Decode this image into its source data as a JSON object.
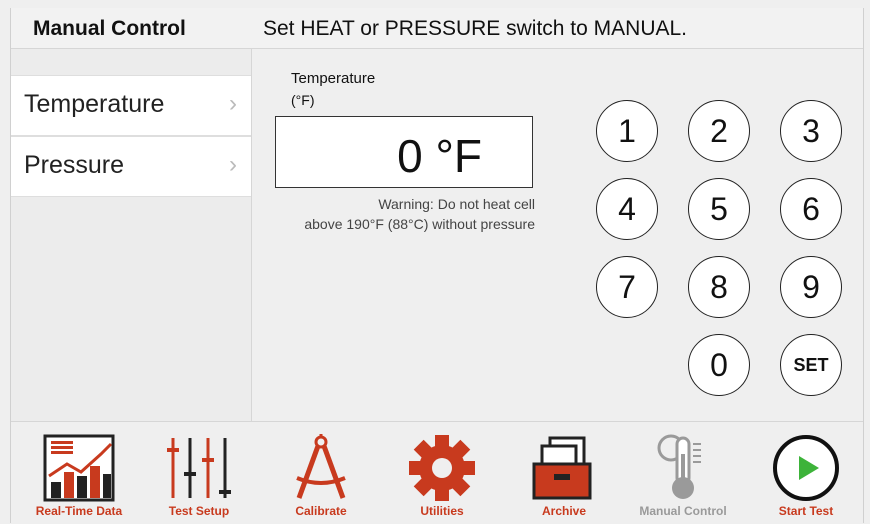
{
  "header": {
    "title": "Manual Control",
    "message": "Set HEAT or PRESSURE switch to MANUAL."
  },
  "menu": {
    "items": [
      {
        "label": "Temperature",
        "chevron": "›"
      },
      {
        "label": "Pressure",
        "chevron": "›"
      }
    ]
  },
  "temperature": {
    "title": "Temperature",
    "unit": "(°F)",
    "value": "0 °F",
    "warning_line1": "Warning: Do not heat cell",
    "warning_line2": "above 190°F (88°C) without pressure"
  },
  "keypad": {
    "keys": [
      "1",
      "2",
      "3",
      "4",
      "5",
      "6",
      "7",
      "8",
      "9",
      "0",
      "SET"
    ]
  },
  "toolbar": {
    "items": [
      {
        "label": "Real-Time Data",
        "icon": "chart-icon"
      },
      {
        "label": "Test Setup",
        "icon": "sliders-icon"
      },
      {
        "label": "Calibrate",
        "icon": "compass-icon"
      },
      {
        "label": "Utilities",
        "icon": "gear-icon"
      },
      {
        "label": "Archive",
        "icon": "file-cabinet-icon"
      },
      {
        "label": "Manual Control",
        "icon": "thermometer-gauge-icon"
      },
      {
        "label": "Start Test",
        "icon": "play-icon"
      }
    ]
  },
  "colors": {
    "accent": "#c83a1e",
    "play": "#3db33a",
    "disabled": "#9a9a9a"
  }
}
